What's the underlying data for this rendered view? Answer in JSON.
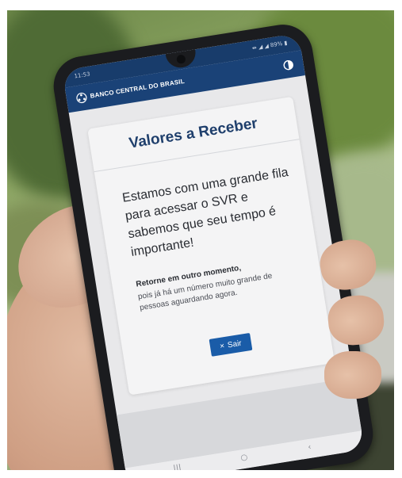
{
  "status_bar": {
    "time": "11:53",
    "indicators": "↮ ◢ ◢ 89% ▮"
  },
  "header": {
    "bank_name": "BANCO CENTRAL DO BRASIL",
    "logo_icon": "bcb-logo-icon",
    "theme_icon": "contrast-icon"
  },
  "card": {
    "title": "Valores a Receber",
    "message": "Estamos com uma grande fila para acessar o SVR e sabemos que seu tempo é importante!",
    "strong_text": "Retorne em outro momento,",
    "detail_text": "pois já há um número muito grande de pessoas aguardando agora."
  },
  "button": {
    "icon": "×",
    "label": "Sair"
  },
  "nav": {
    "recents": "|||",
    "home": "○",
    "back": "‹"
  },
  "colors": {
    "header": "#1a4277",
    "button": "#1a5ca8",
    "title": "#1f3f6c"
  }
}
